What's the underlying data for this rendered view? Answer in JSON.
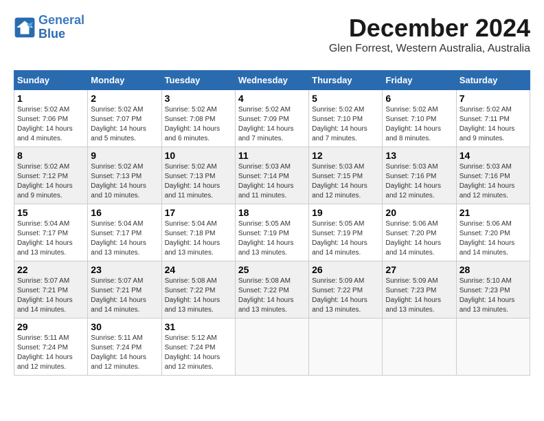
{
  "header": {
    "logo_line1": "General",
    "logo_line2": "Blue",
    "month": "December 2024",
    "location": "Glen Forrest, Western Australia, Australia"
  },
  "weekdays": [
    "Sunday",
    "Monday",
    "Tuesday",
    "Wednesday",
    "Thursday",
    "Friday",
    "Saturday"
  ],
  "weeks": [
    [
      {
        "day": "1",
        "sunrise": "5:02 AM",
        "sunset": "7:06 PM",
        "daylight": "14 hours and 4 minutes."
      },
      {
        "day": "2",
        "sunrise": "5:02 AM",
        "sunset": "7:07 PM",
        "daylight": "14 hours and 5 minutes."
      },
      {
        "day": "3",
        "sunrise": "5:02 AM",
        "sunset": "7:08 PM",
        "daylight": "14 hours and 6 minutes."
      },
      {
        "day": "4",
        "sunrise": "5:02 AM",
        "sunset": "7:09 PM",
        "daylight": "14 hours and 7 minutes."
      },
      {
        "day": "5",
        "sunrise": "5:02 AM",
        "sunset": "7:10 PM",
        "daylight": "14 hours and 7 minutes."
      },
      {
        "day": "6",
        "sunrise": "5:02 AM",
        "sunset": "7:10 PM",
        "daylight": "14 hours and 8 minutes."
      },
      {
        "day": "7",
        "sunrise": "5:02 AM",
        "sunset": "7:11 PM",
        "daylight": "14 hours and 9 minutes."
      }
    ],
    [
      {
        "day": "8",
        "sunrise": "5:02 AM",
        "sunset": "7:12 PM",
        "daylight": "14 hours and 9 minutes."
      },
      {
        "day": "9",
        "sunrise": "5:02 AM",
        "sunset": "7:13 PM",
        "daylight": "14 hours and 10 minutes."
      },
      {
        "day": "10",
        "sunrise": "5:02 AM",
        "sunset": "7:13 PM",
        "daylight": "14 hours and 11 minutes."
      },
      {
        "day": "11",
        "sunrise": "5:03 AM",
        "sunset": "7:14 PM",
        "daylight": "14 hours and 11 minutes."
      },
      {
        "day": "12",
        "sunrise": "5:03 AM",
        "sunset": "7:15 PM",
        "daylight": "14 hours and 12 minutes."
      },
      {
        "day": "13",
        "sunrise": "5:03 AM",
        "sunset": "7:16 PM",
        "daylight": "14 hours and 12 minutes."
      },
      {
        "day": "14",
        "sunrise": "5:03 AM",
        "sunset": "7:16 PM",
        "daylight": "14 hours and 12 minutes."
      }
    ],
    [
      {
        "day": "15",
        "sunrise": "5:04 AM",
        "sunset": "7:17 PM",
        "daylight": "14 hours and 13 minutes."
      },
      {
        "day": "16",
        "sunrise": "5:04 AM",
        "sunset": "7:17 PM",
        "daylight": "14 hours and 13 minutes."
      },
      {
        "day": "17",
        "sunrise": "5:04 AM",
        "sunset": "7:18 PM",
        "daylight": "14 hours and 13 minutes."
      },
      {
        "day": "18",
        "sunrise": "5:05 AM",
        "sunset": "7:19 PM",
        "daylight": "14 hours and 13 minutes."
      },
      {
        "day": "19",
        "sunrise": "5:05 AM",
        "sunset": "7:19 PM",
        "daylight": "14 hours and 14 minutes."
      },
      {
        "day": "20",
        "sunrise": "5:06 AM",
        "sunset": "7:20 PM",
        "daylight": "14 hours and 14 minutes."
      },
      {
        "day": "21",
        "sunrise": "5:06 AM",
        "sunset": "7:20 PM",
        "daylight": "14 hours and 14 minutes."
      }
    ],
    [
      {
        "day": "22",
        "sunrise": "5:07 AM",
        "sunset": "7:21 PM",
        "daylight": "14 hours and 14 minutes."
      },
      {
        "day": "23",
        "sunrise": "5:07 AM",
        "sunset": "7:21 PM",
        "daylight": "14 hours and 14 minutes."
      },
      {
        "day": "24",
        "sunrise": "5:08 AM",
        "sunset": "7:22 PM",
        "daylight": "14 hours and 13 minutes."
      },
      {
        "day": "25",
        "sunrise": "5:08 AM",
        "sunset": "7:22 PM",
        "daylight": "14 hours and 13 minutes."
      },
      {
        "day": "26",
        "sunrise": "5:09 AM",
        "sunset": "7:22 PM",
        "daylight": "14 hours and 13 minutes."
      },
      {
        "day": "27",
        "sunrise": "5:09 AM",
        "sunset": "7:23 PM",
        "daylight": "14 hours and 13 minutes."
      },
      {
        "day": "28",
        "sunrise": "5:10 AM",
        "sunset": "7:23 PM",
        "daylight": "14 hours and 13 minutes."
      }
    ],
    [
      {
        "day": "29",
        "sunrise": "5:11 AM",
        "sunset": "7:24 PM",
        "daylight": "14 hours and 12 minutes."
      },
      {
        "day": "30",
        "sunrise": "5:11 AM",
        "sunset": "7:24 PM",
        "daylight": "14 hours and 12 minutes."
      },
      {
        "day": "31",
        "sunrise": "5:12 AM",
        "sunset": "7:24 PM",
        "daylight": "14 hours and 12 minutes."
      },
      null,
      null,
      null,
      null
    ]
  ],
  "labels": {
    "sunrise": "Sunrise:",
    "sunset": "Sunset:",
    "daylight": "Daylight:"
  }
}
